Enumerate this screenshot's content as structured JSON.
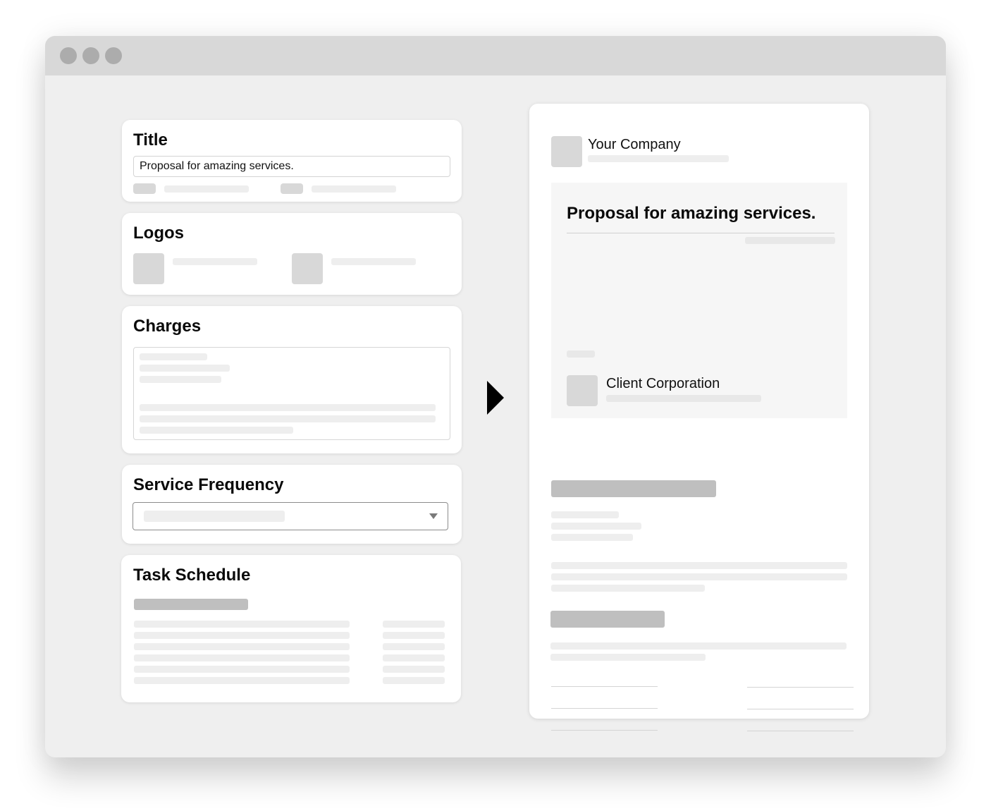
{
  "window": {
    "traffic_lights": [
      "close",
      "minimize",
      "zoom"
    ]
  },
  "editor": {
    "title_card": {
      "heading": "Title",
      "input_value": "Proposal for amazing services."
    },
    "logos_card": {
      "heading": "Logos"
    },
    "charges_card": {
      "heading": "Charges"
    },
    "frequency_card": {
      "heading": "Service Frequency",
      "select_icon": "caret-down-icon"
    },
    "tasks_card": {
      "heading": "Task Schedule"
    }
  },
  "flow_arrow_icon": "play-arrow-icon",
  "preview": {
    "company_name": "Your Company",
    "document_title": "Proposal for amazing services.",
    "client_name": "Client Corporation"
  },
  "colors": {
    "window_bg": "#efefef",
    "titlebar": "#d8d8d8",
    "traffic_light": "#acacac",
    "card_bg": "#ffffff",
    "skeleton_light": "#eeeeee",
    "skeleton_mid": "#d8d8d8",
    "skeleton_dark": "#bfbfbf",
    "title_panel": "#f6f6f6"
  }
}
